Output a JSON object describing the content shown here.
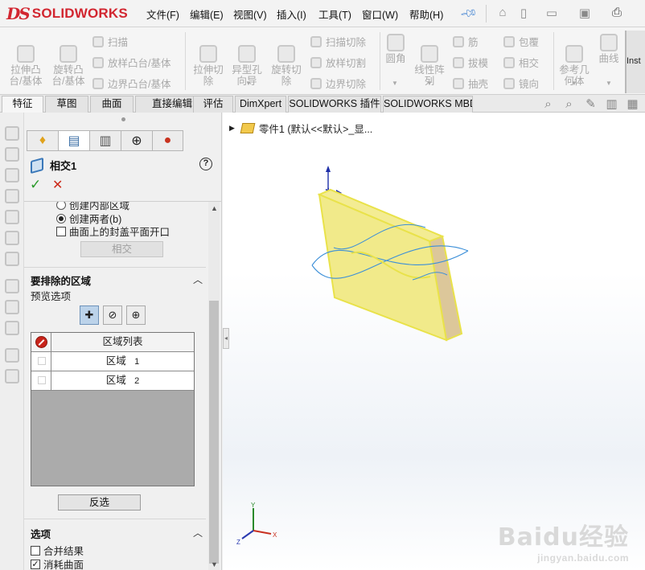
{
  "app": {
    "logo_ds": "DS",
    "logo_name": "SOLIDWORKS"
  },
  "menu": [
    "文件(F)",
    "编辑(E)",
    "视图(V)",
    "插入(I)",
    "工具(T)",
    "窗口(W)",
    "帮助(H)"
  ],
  "ribbon": {
    "extruded_boss": "拉伸凸\n台/基体",
    "revolved_boss": "旋转凸\n台/基体",
    "sweep": "扫描",
    "loft": "放样凸台/基体",
    "boundary": "边界凸台/基体",
    "extruded_cut": "拉伸切\n除",
    "hole_wizard": "异型孔\n向导",
    "revolved_cut": "旋转切\n除",
    "swept_cut": "扫描切除",
    "lofted_cut": "放样切割",
    "boundary_cut": "边界切除",
    "fillet": "圆角",
    "linear_pattern": "线性阵\n列",
    "rib": "筋",
    "draft": "拔模",
    "shell": "抽壳",
    "wrap": "包覆",
    "intersect": "相交",
    "mirror": "镜向",
    "reference_geometry": "参考几\n何体",
    "curves": "曲线",
    "instant3d": "Inst"
  },
  "tabs": [
    "特征",
    "草图",
    "曲面",
    "直接编辑",
    "评估",
    "DimXpert",
    "SOLIDWORKS 插件",
    "SOLIDWORKS MBD"
  ],
  "active_tab": "特征",
  "feature_manager": {
    "part_name": "零件1  (默认<<默认>_显..."
  },
  "property_manager": {
    "title": "相交1",
    "help": "?",
    "ok_symbol": "✓",
    "cancel_symbol": "✕",
    "hidden_option": "创建内部区域",
    "radio_both": "创建两者(b)",
    "cap_planar": "曲面上的封盖平面开口",
    "cap_planar_checked": false,
    "intersect_button": "相交",
    "section_exclude": "要排除的区域",
    "preview_label": "预览选项",
    "region_table_header": "区域列表",
    "regions": [
      {
        "name": "区域",
        "number": "1"
      },
      {
        "name": "区域",
        "number": "2"
      }
    ],
    "flip_button": "反选",
    "section_options": "选项",
    "merge_result": "合并结果",
    "merge_result_checked": false,
    "consume_surfaces": "消耗曲面",
    "consume_surfaces_checked": true
  },
  "watermark": {
    "line1": "Baidu经验",
    "line2": "jingyan.baidu.com"
  },
  "colors": {
    "brand": "#d22630",
    "part_face": "#f1ea8a",
    "part_edge": "#e9e24a",
    "part_side": "#dcc79a",
    "surface_curve": "#3b8fd8",
    "accent_blue": "#3b7fd1"
  }
}
